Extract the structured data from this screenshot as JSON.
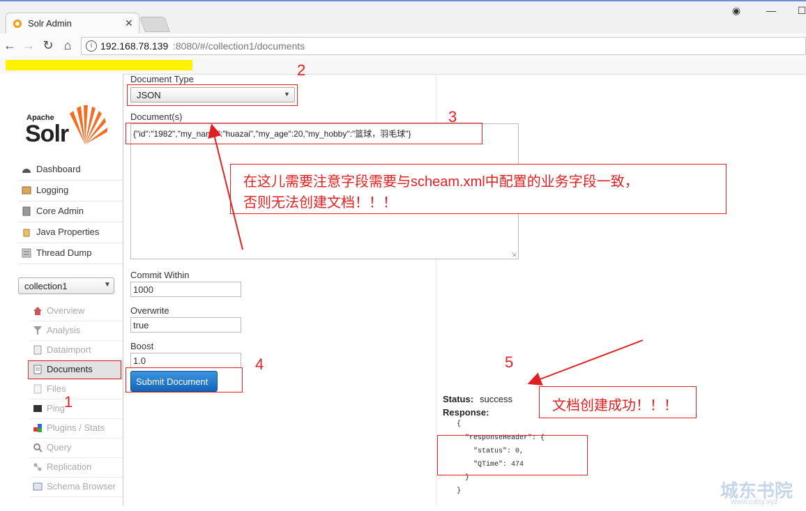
{
  "browser": {
    "tab_title": "Solr Admin",
    "url_host": "192.168.78.139",
    "url_rest": ":8080/#/collection1/documents"
  },
  "logo": {
    "small": "Apache",
    "big": "Solr"
  },
  "sidebar": {
    "menu": [
      {
        "label": "Dashboard",
        "icon": "dashboard-icon"
      },
      {
        "label": "Logging",
        "icon": "logging-icon"
      },
      {
        "label": "Core Admin",
        "icon": "core-admin-icon"
      },
      {
        "label": "Java Properties",
        "icon": "java-icon"
      },
      {
        "label": "Thread Dump",
        "icon": "thread-dump-icon"
      }
    ],
    "core_selector": "collection1",
    "core_menu": [
      {
        "label": "Overview",
        "icon": "home-icon"
      },
      {
        "label": "Analysis",
        "icon": "filter-icon"
      },
      {
        "label": "Dataimport",
        "icon": "import-icon"
      },
      {
        "label": "Documents",
        "icon": "documents-icon"
      },
      {
        "label": "Files",
        "icon": "files-icon"
      },
      {
        "label": "Ping",
        "icon": "ping-icon"
      },
      {
        "label": "Plugins / Stats",
        "icon": "plugins-icon"
      },
      {
        "label": "Query",
        "icon": "query-icon"
      },
      {
        "label": "Replication",
        "icon": "replication-icon"
      },
      {
        "label": "Schema Browser",
        "icon": "schema-icon"
      }
    ]
  },
  "form": {
    "document_type_label": "Document Type",
    "document_type_value": "JSON",
    "documents_label": "Document(s)",
    "documents_value": "{\"id\":\"1982\",\"my_name\":\"huazai\",\"my_age\":20,\"my_hobby\":\"篮球，羽毛球\"}",
    "commit_within_label": "Commit Within",
    "commit_within_value": "1000",
    "overwrite_label": "Overwrite",
    "overwrite_value": "true",
    "boost_label": "Boost",
    "boost_value": "1.0",
    "submit_label": "Submit Document"
  },
  "result": {
    "status_label": "Status:",
    "status_value": "success",
    "response_label": "Response:",
    "lines": [
      "{",
      "\"responseHeader\": {",
      "\"status\": 0,",
      "\"QTime\": 474",
      "}",
      "}"
    ]
  },
  "annotations": {
    "n1": "1",
    "n2": "2",
    "n3": "3",
    "n4": "4",
    "n5": "5",
    "note_line1": "在这儿需要注意字段需要与scheam.xml中配置的业务字段一致，",
    "note_line2": "否则无法创建文档！！！",
    "success_note": "文档创建成功！！！",
    "watermark": "城东书院",
    "watermark_url": "www.cdsy.xyz"
  },
  "colors": {
    "annotation_red": "#e02020",
    "submit_blue": "#1a78c8",
    "highlight_yellow": "#fff200"
  }
}
